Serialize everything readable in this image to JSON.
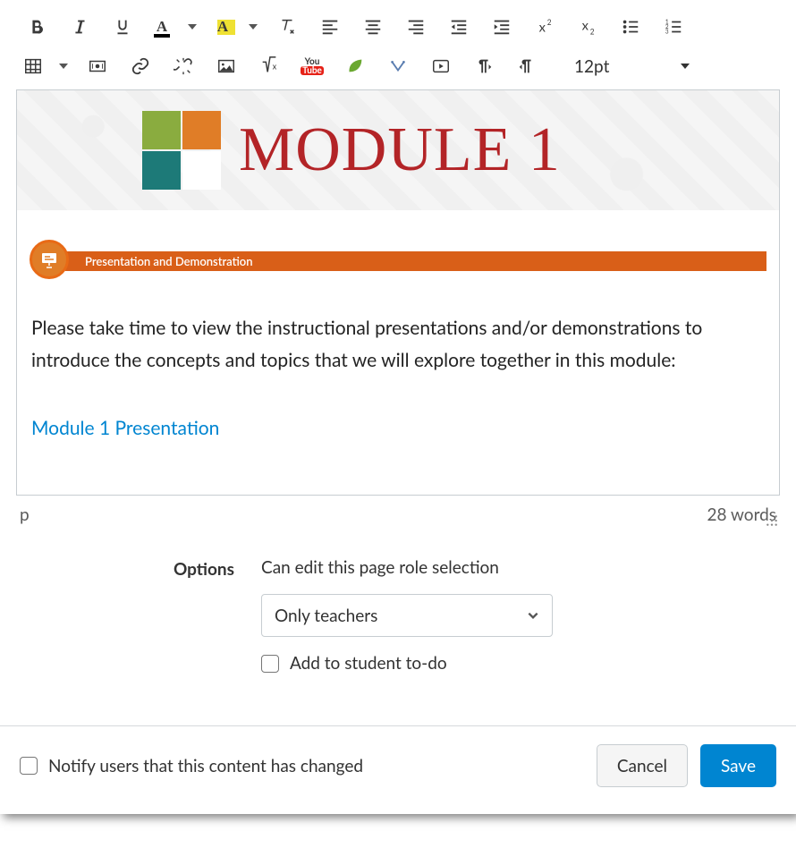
{
  "toolbar": {
    "font_size": "12pt"
  },
  "content": {
    "banner_title": "MODULE 1",
    "section_label": "Presentation and Demonstration",
    "body_text": "Please take time to view the instructional presentations and/or demonstrations to introduce the concepts and topics that we will explore together in this module:",
    "link_text": "Module 1 Presentation"
  },
  "status": {
    "path": "p",
    "word_count": "28 words"
  },
  "options": {
    "heading": "Options",
    "edit_label": "Can edit this page role selection",
    "role_value": "Only teachers",
    "todo_label": "Add to student to-do"
  },
  "footer": {
    "notify_label": "Notify users that this content has changed",
    "cancel": "Cancel",
    "save": "Save"
  }
}
